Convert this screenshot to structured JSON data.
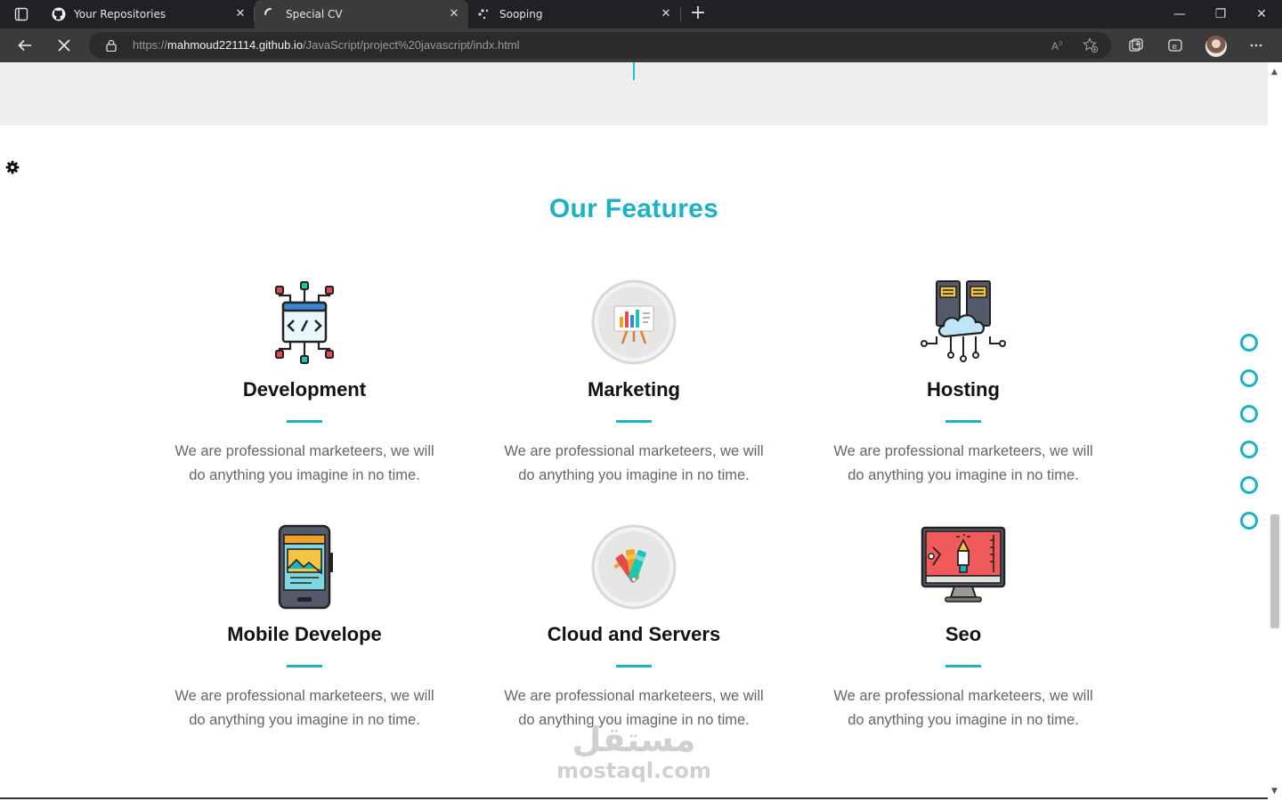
{
  "browser": {
    "tabs": [
      {
        "label": "Your Repositories",
        "icon": "github-icon"
      },
      {
        "label": "Special CV",
        "icon": "loading-spinner-icon",
        "active": true
      },
      {
        "label": "Sooping",
        "icon": "loading-dots-icon"
      }
    ],
    "url": {
      "scheme": "https://",
      "host": "mahmoud221114.github.io",
      "path": "/JavaScript/project%20javascript/indx.html"
    },
    "window_controls": {
      "minimize": "—",
      "restore": "❐",
      "close": "✕"
    },
    "close_tab_glyph": "✕",
    "new_tab_glyph": "+"
  },
  "page": {
    "section_title": "Our Features",
    "accent_color": "#19b2c6",
    "features": [
      {
        "title": "Development",
        "icon": "code-network-icon",
        "description": "We are professional marketeers, we will do anything you imagine in no time."
      },
      {
        "title": "Marketing",
        "icon": "presentation-chart-icon",
        "description": "We are professional marketeers, we will do anything you imagine in no time."
      },
      {
        "title": "Hosting",
        "icon": "cloud-server-icon",
        "description": "We are professional marketeers, we will do anything you imagine in no time."
      },
      {
        "title": "Mobile Develope",
        "icon": "mobile-app-icon",
        "description": "We are professional marketeers, we will do anything you imagine in no time."
      },
      {
        "title": "Cloud and Servers",
        "icon": "color-palette-icon",
        "description": "We are professional marketeers, we will do anything you imagine in no time."
      },
      {
        "title": "Seo",
        "icon": "monitor-design-icon",
        "description": "We are professional marketeers, we will do anything you imagine in no time."
      }
    ],
    "nav_bullets": 6,
    "watermark": {
      "arabic": "مستقل",
      "latin": "mostaql.com"
    }
  }
}
